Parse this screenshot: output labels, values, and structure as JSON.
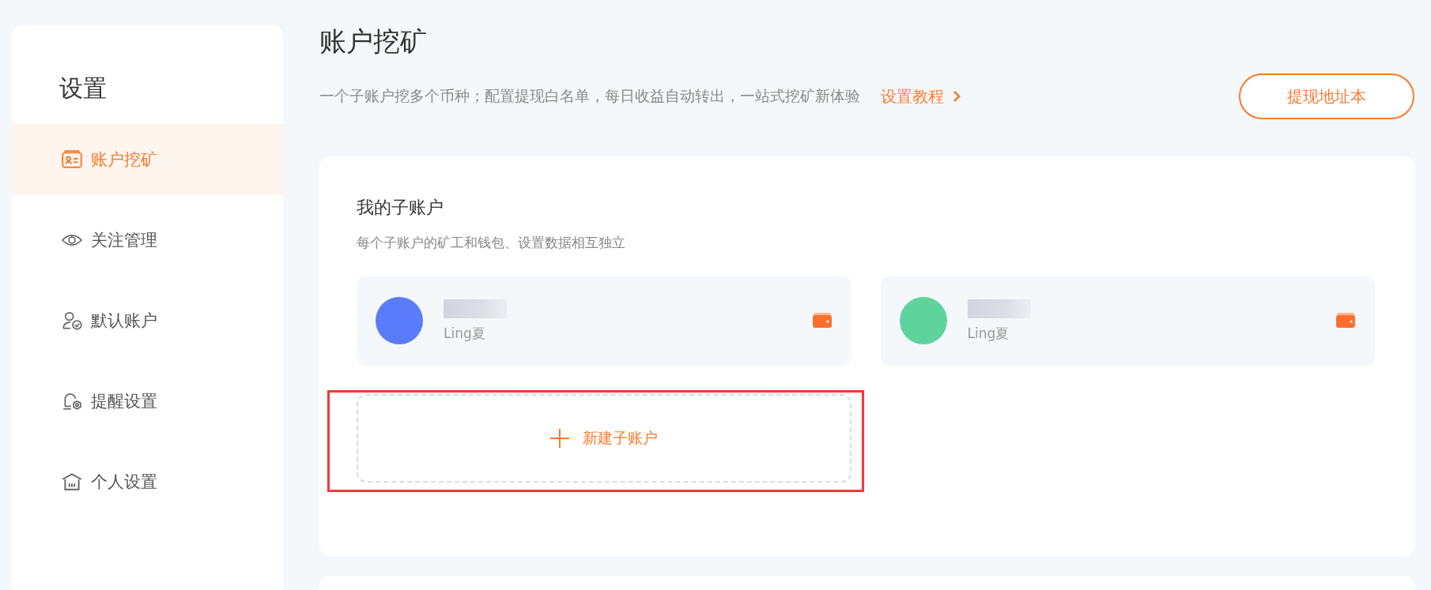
{
  "sidebar": {
    "title": "设置",
    "items": [
      {
        "label": "账户挖矿",
        "selected": true
      },
      {
        "label": "关注管理",
        "selected": false
      },
      {
        "label": "默认账户",
        "selected": false
      },
      {
        "label": "提醒设置",
        "selected": false
      },
      {
        "label": "个人设置",
        "selected": false
      }
    ]
  },
  "header": {
    "title": "账户挖矿",
    "description": "一个子账户挖多个币种；配置提现白名单，每日收益自动转出，一站式挖矿新体验",
    "tutorial_link": "设置教程",
    "address_book_button": "提现地址本"
  },
  "sub_accounts": {
    "title": "我的子账户",
    "description": "每个子账户的矿工和钱包、设置数据相互独立",
    "accounts": [
      {
        "owner": "Ling夏",
        "color": "#5b7cfa"
      },
      {
        "owner": "Ling夏",
        "color": "#5fd39c"
      }
    ],
    "new_account_button": "新建子账户"
  }
}
